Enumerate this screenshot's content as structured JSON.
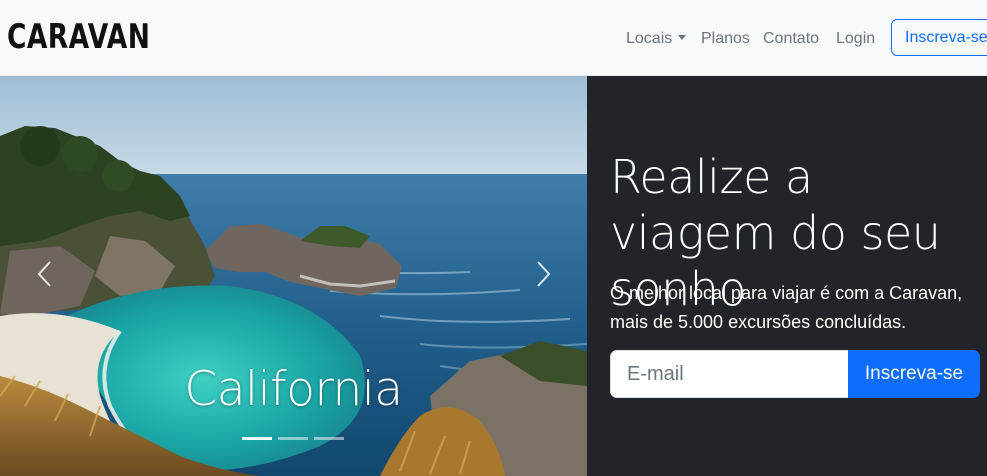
{
  "navbar": {
    "brand": "CARAVAN",
    "items": [
      {
        "label": "Locais",
        "has_dropdown": true
      },
      {
        "label": "Planos"
      },
      {
        "label": "Contato"
      },
      {
        "label": "Login"
      }
    ],
    "signup_label": "Inscreva-se"
  },
  "carousel": {
    "slides": [
      {
        "caption": "California",
        "scene": "coastal-cove-photo"
      }
    ],
    "indicator_count": 3,
    "active_index": 0,
    "prev_icon": "chevron-left-icon",
    "next_icon": "chevron-right-icon"
  },
  "hero": {
    "title": "Realize a viagem do seu sonho",
    "subtitle": "O melhor local para viajar é com a Caravan, mais de 5.000 excursões concluídas.",
    "email_placeholder": "E-mail",
    "email_value": "",
    "cta_label": "Inscreva-se"
  },
  "colors": {
    "primary": "#0d6efd",
    "hero_bg": "#212529",
    "navbar_bg": "#f8f9fa",
    "nav_text": "#6c757d"
  }
}
